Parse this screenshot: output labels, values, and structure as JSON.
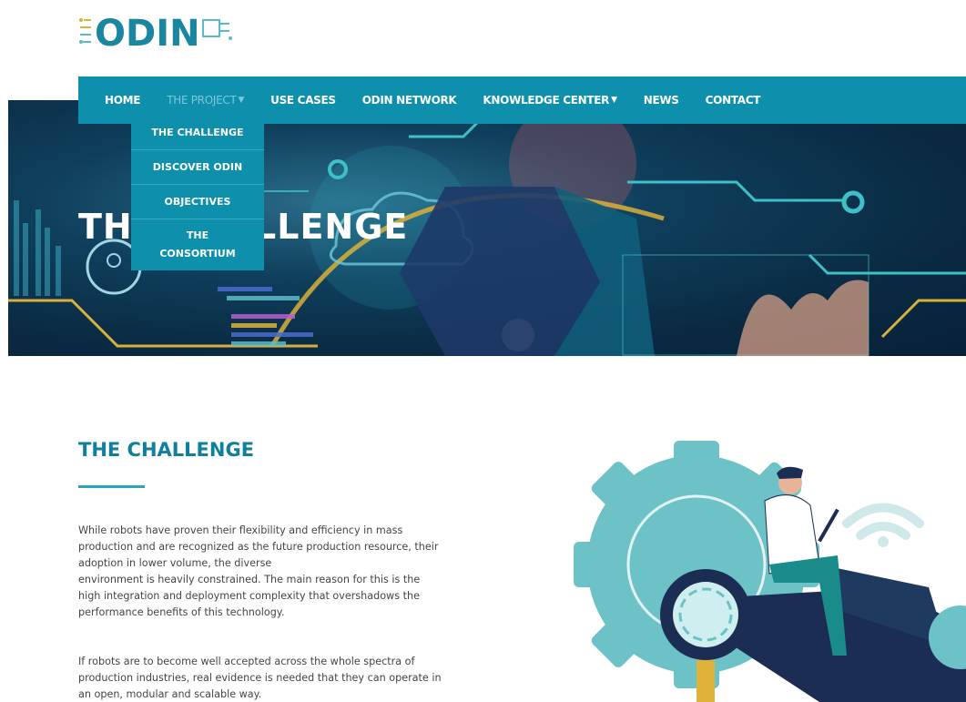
{
  "logo": {
    "text": "ODIN"
  },
  "nav": {
    "items": [
      {
        "label": "HOME",
        "active": false,
        "dropdown": false
      },
      {
        "label": "THE PROJECT",
        "active": true,
        "dropdown": true
      },
      {
        "label": "USE CASES",
        "active": false,
        "dropdown": false
      },
      {
        "label": "ODIN NETWORK",
        "active": false,
        "dropdown": false
      },
      {
        "label": "KNOWLEDGE CENTER",
        "active": false,
        "dropdown": true
      },
      {
        "label": "NEWS",
        "active": false,
        "dropdown": false
      },
      {
        "label": "CONTACT",
        "active": false,
        "dropdown": false
      }
    ],
    "dropdown_items": [
      "THE CHALLENGE",
      "DISCOVER ODIN",
      "OBJECTIVES",
      "THE",
      "CONSORTIUM"
    ]
  },
  "hero": {
    "title": "THE CHALLENGE"
  },
  "content": {
    "title": "THE CHALLENGE",
    "paragraph1": [
      "While robots have proven their flexibility and efficiency in mass",
      "production and are recognized as the future production resource, their",
      "adoption in lower volume, the diverse",
      "environment is heavily constrained. The main reason for this is the",
      "high integration and deployment complexity that overshadows the",
      "performance benefits of this technology."
    ],
    "paragraph2": [
      "If robots are to become well accepted across the whole spectra of",
      "production industries, real evidence is needed that they can operate in",
      "an open, modular and scalable way."
    ]
  },
  "colors": {
    "nav_bg": "#0e8fab",
    "accent": "#0e7f9c",
    "teal_light": "#5bbcc7",
    "gold": "#e0b23a"
  }
}
